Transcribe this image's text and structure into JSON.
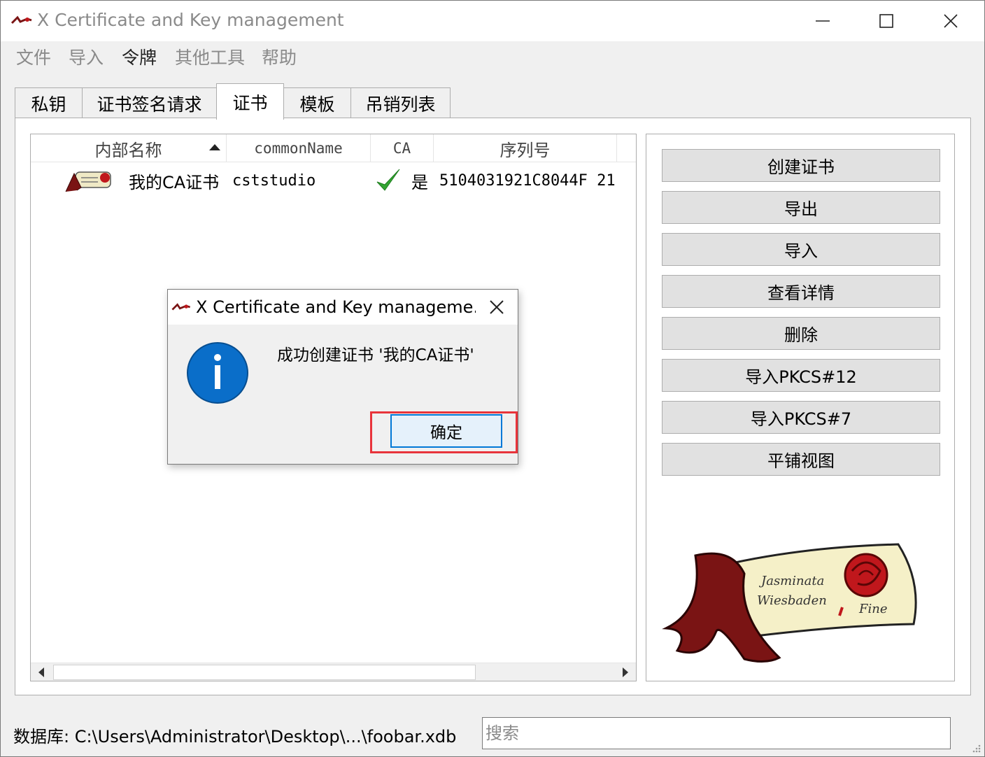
{
  "window": {
    "title": "X Certificate and Key management"
  },
  "menu": {
    "items": [
      "文件",
      "导入",
      "令牌",
      "其他工具",
      "帮助"
    ]
  },
  "tabs": [
    {
      "label": "私钥",
      "active": false
    },
    {
      "label": "证书签名请求",
      "active": false
    },
    {
      "label": "证书",
      "active": true
    },
    {
      "label": "模板",
      "active": false
    },
    {
      "label": "吊销列表",
      "active": false
    }
  ],
  "list": {
    "columns": [
      "内部名称",
      "commonName",
      "CA",
      "序列号"
    ],
    "sort_column": "内部名称",
    "rows": [
      {
        "internal_name": "我的CA证书",
        "common_name": "cststudio",
        "ca_icon": "checkmark-icon",
        "ca": "是",
        "serial": "5104031921C8044F 21"
      }
    ]
  },
  "side_buttons": [
    "创建证书",
    "导出",
    "导入",
    "查看详情",
    "删除",
    "导入PKCS#12",
    "导入PKCS#7",
    "平铺视图"
  ],
  "status": {
    "database_label": "数据库: C:\\Users\\Administrator\\Desktop\\...\\foobar.xdb",
    "search_placeholder": "搜索"
  },
  "dialog": {
    "title": "X Certificate and Key manageme...",
    "icon": "info-icon",
    "message": "成功创建证书 '我的CA证书'",
    "ok_label": "确定"
  },
  "colors": {
    "accent": "#0078d7",
    "info_icon": "#0a6ec9",
    "highlight": "#e8343b",
    "check": "#33a532",
    "scroll_ribbon": "#7a1414",
    "scroll_paper": "#f5f0c8"
  },
  "logo": {
    "script_line1": "Jasminata",
    "script_line2": "Wiesbaden",
    "script_line3": "Fine"
  }
}
